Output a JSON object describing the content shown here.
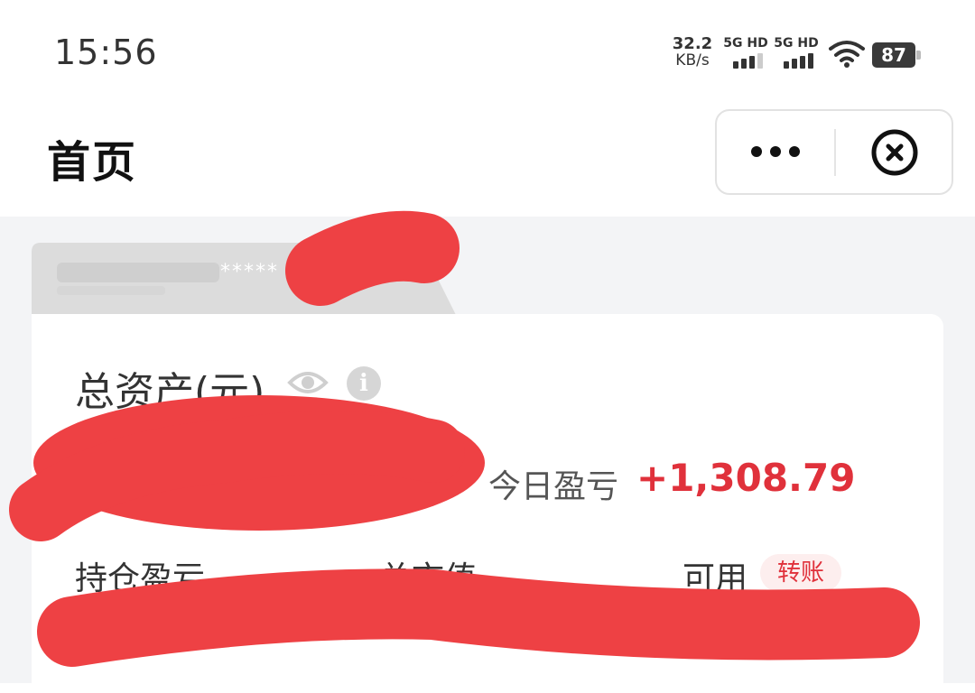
{
  "status_bar": {
    "time": "15:56",
    "net_speed": "32.2",
    "net_unit": "KB/s",
    "sim1_label": "5G HD",
    "sim2_label": "5G HD",
    "battery": "87"
  },
  "nav": {
    "title": "首页"
  },
  "account": {
    "masked_number": "*****"
  },
  "assets": {
    "total_label": "总资产(元)",
    "info_glyph": "i",
    "today_pnl_label": "今日盈亏",
    "today_pnl_value": "+1,308.79",
    "position_pnl_label": "持仓盈亏",
    "market_value_label": "总市值",
    "available_label": "可用",
    "transfer_label": "转账"
  },
  "colors": {
    "profit_red": "#e0313b",
    "page_bg": "#f3f4f6",
    "redaction": "#ee4144"
  },
  "icons": [
    "more-dots-icon",
    "close-circle-icon",
    "eye-icon",
    "info-icon",
    "wifi-icon",
    "battery-icon",
    "signal-icon"
  ]
}
